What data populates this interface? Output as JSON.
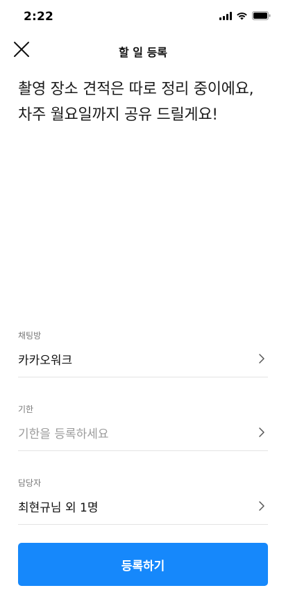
{
  "status_bar": {
    "time": "2:22",
    "icons": [
      "signal-icon",
      "wifi-icon",
      "battery-icon"
    ]
  },
  "header": {
    "title": "할 일 등록",
    "close_icon": "close-icon"
  },
  "task": {
    "content": "촬영 장소 견적은 따로 정리 중이에요, 차주 월요일까지 공유 드릴게요!"
  },
  "fields": {
    "chat_room": {
      "label": "채팅방",
      "value": "카카오워크"
    },
    "deadline": {
      "label": "기한",
      "placeholder": "기한을 등록하세요"
    },
    "assignee": {
      "label": "담당자",
      "value": "최현규님 외 1명"
    }
  },
  "submit": {
    "label": "등록하기"
  },
  "colors": {
    "accent": "#1688fb",
    "divider": "#e3e3e3",
    "label": "#777777",
    "placeholder": "#9b9b9b"
  }
}
